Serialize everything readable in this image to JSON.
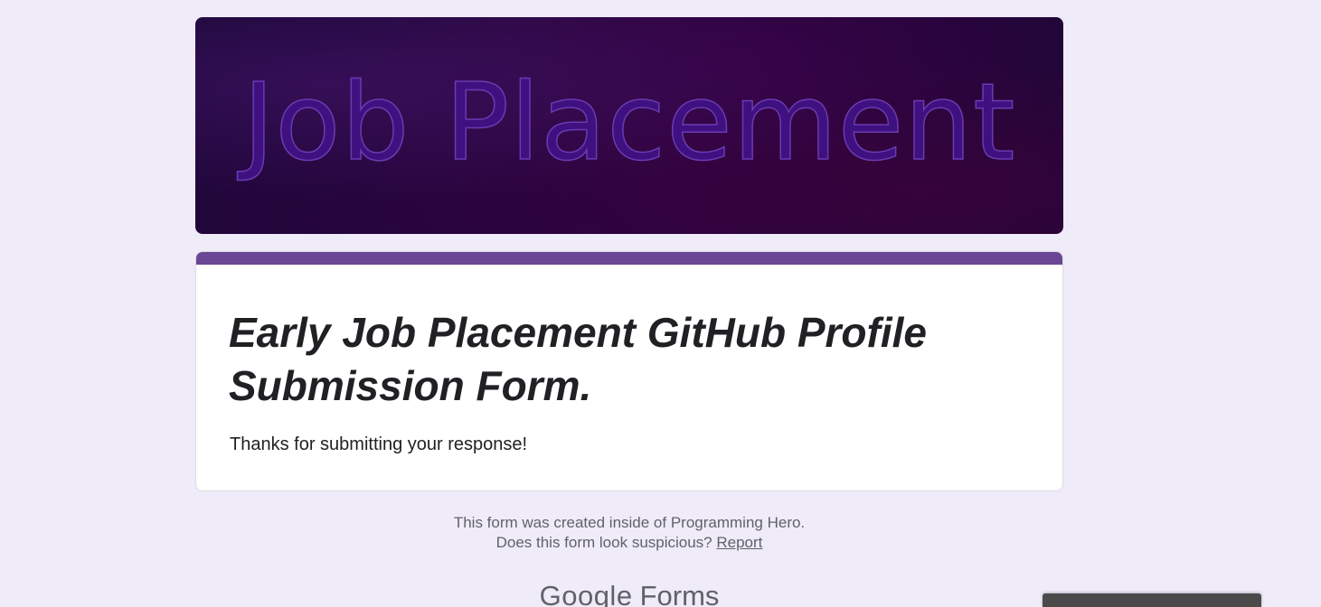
{
  "banner": {
    "title": "Job Placement"
  },
  "form": {
    "title": "Early Job Placement GitHub Profile Submission Form.",
    "confirmation_message": "Thanks for submitting your response!",
    "accent_color": "#673ab7"
  },
  "footer": {
    "created_text": "This form was created inside of Programming Hero.",
    "suspicious_text": "Does this form look suspicious?",
    "report_link": "Report"
  },
  "branding": {
    "google": "Google",
    "forms": "Forms"
  },
  "colors": {
    "page_background": "#f0ebf8",
    "banner_background": "#1f0839",
    "banner_text": "#3f1080"
  }
}
